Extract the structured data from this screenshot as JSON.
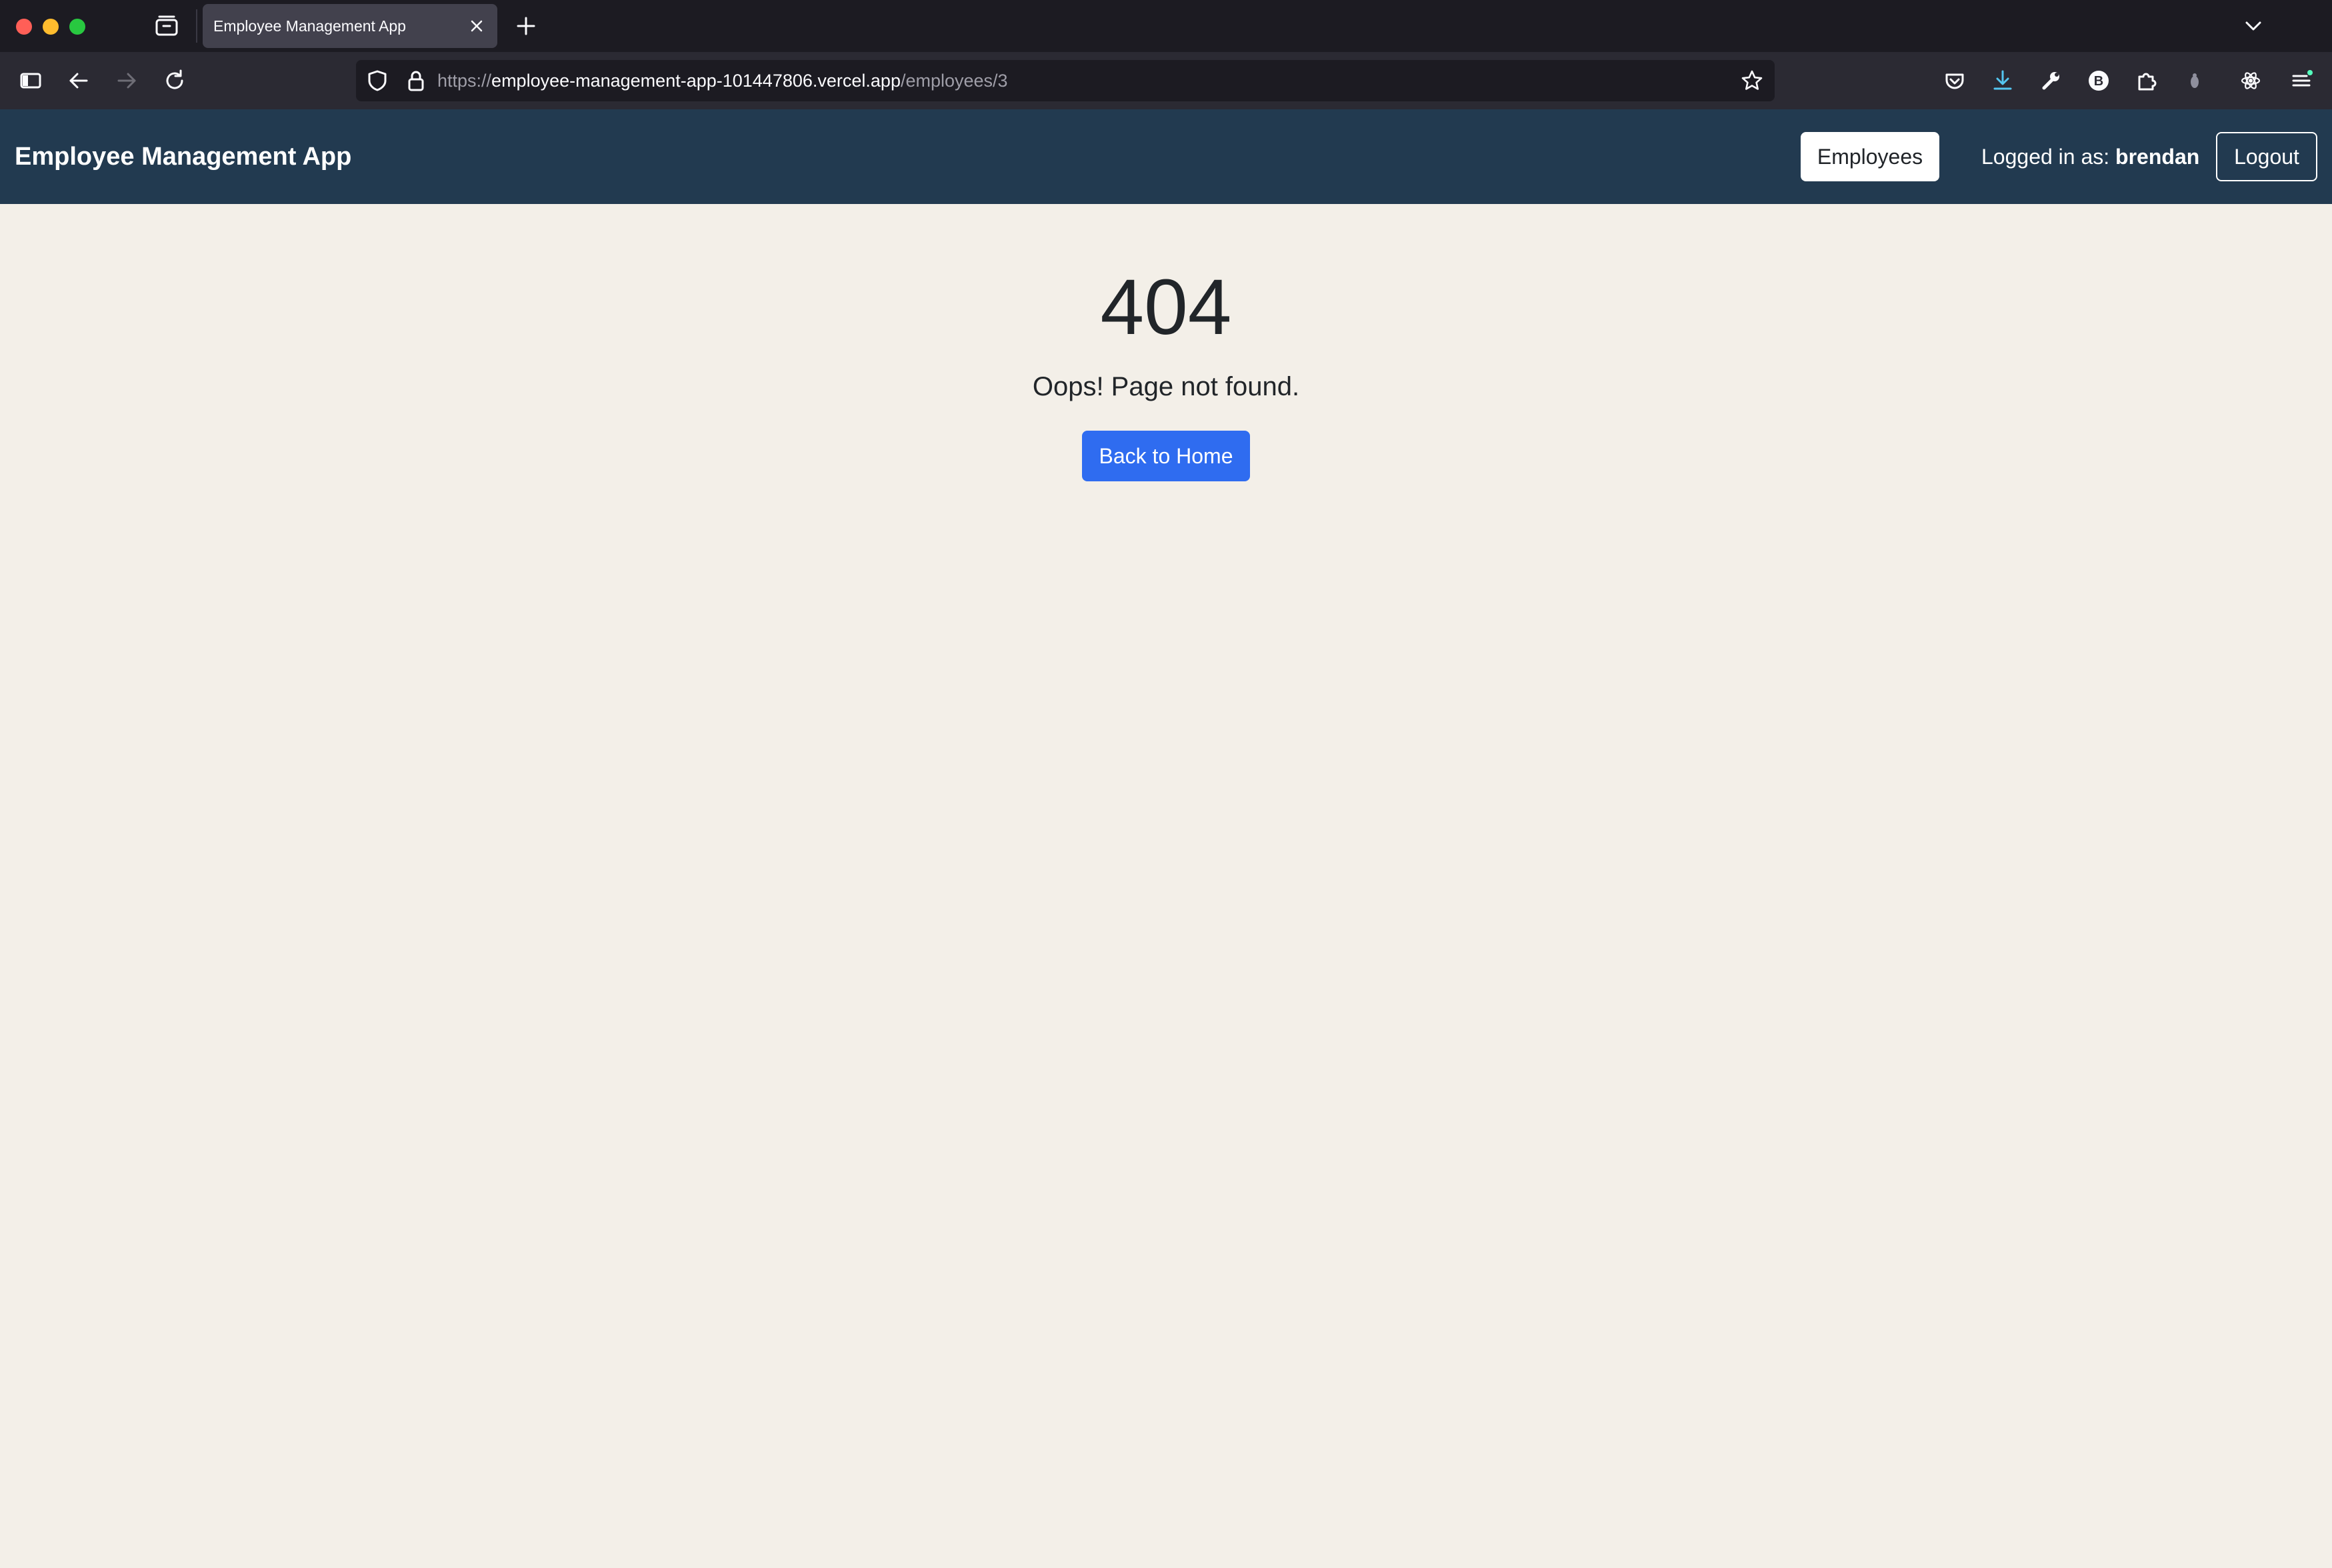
{
  "browser": {
    "tab": {
      "title": "Employee Management App"
    },
    "url": {
      "scheme": "https://",
      "host": "employee-management-app-101447806.vercel.app",
      "path": "/employees/3"
    },
    "extension_badge_letter": "B"
  },
  "navbar": {
    "brand": "Employee Management App",
    "employees_label": "Employees",
    "logged_in_prefix": "Logged in as:",
    "username": "brendan",
    "logout_label": "Logout"
  },
  "error": {
    "code": "404",
    "message": "Oops! Page not found.",
    "button_label": "Back to Home"
  },
  "colors": {
    "navbar_bg": "#223a50",
    "page_bg": "#f3efe8",
    "primary_button": "#2f6cf0"
  }
}
